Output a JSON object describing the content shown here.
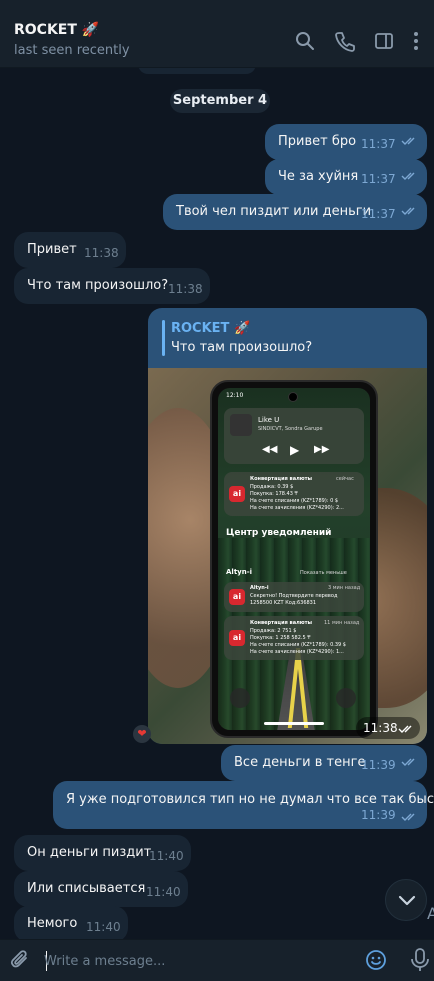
{
  "header": {
    "title": "ROCKET 🚀",
    "status": "last seen recently"
  },
  "date_separator": "September 4",
  "messages": [
    {
      "text": "Привет бро",
      "time": "11:37",
      "dir": "out"
    },
    {
      "text": "Че за хуйня",
      "time": "11:37",
      "dir": "out"
    },
    {
      "text": "Твой чел пиздит или деньги",
      "time": "11:37",
      "dir": "out"
    },
    {
      "text": "Привет",
      "time": "11:38",
      "dir": "in"
    },
    {
      "text": "Что там произошло?",
      "time": "11:38",
      "dir": "in"
    },
    {
      "text": "Все деньги в тенге",
      "time": "11:39",
      "dir": "out"
    },
    {
      "text": "Я уже подготовился тип но не думал что все так быстро",
      "time": "11:39",
      "dir": "out"
    },
    {
      "text": "Он деньги пиздит",
      "time": "11:40",
      "dir": "in"
    },
    {
      "text": "Или  списывается",
      "time": "11:40",
      "dir": "in"
    },
    {
      "text": "Немого",
      "time": "11:40",
      "dir": "in"
    }
  ],
  "media_message": {
    "reply_name": "ROCKET 🚀",
    "reply_text": "Что там произошло?",
    "time": "11:38",
    "reaction": "❤",
    "photo": {
      "status_time": "12:10",
      "music_title": "Like U",
      "music_artist": "SINDICVT, Sondra Garupe",
      "card1": {
        "title": "Конвертация валюты",
        "when": "сейчас",
        "lines": [
          "Продажа: 0.39 $",
          "Покупка: 178.43 ₸",
          "На счете списания (KZ*1789): 0 $",
          "На счете зачисления (KZ*4290): 2..."
        ]
      },
      "center_title": "Центр уведомлений",
      "group_label": "Altyn-i",
      "show_less": "Показать меньше",
      "card2": {
        "title": "Altyn-i",
        "when": "3 мин назад",
        "lines": [
          "Секретно! Подтвердите перевод",
          "1258500 KZT Код:636831"
        ]
      },
      "card3": {
        "title": "Конвертация валюты",
        "when": "11 мин назад",
        "lines": [
          "Продажа: 2 751 $",
          "Покупка: 1 258 582.5 ₸",
          "На счете списания (KZ*1789): 0.39 $",
          "На счете зачисления (KZ*4290): 1..."
        ]
      },
      "app_icon": "ai"
    }
  },
  "input": {
    "placeholder": "Write a message..."
  },
  "icons": {
    "search": "search-icon",
    "call": "phone-icon",
    "sidebar": "sidebar-toggle-icon",
    "more": "more-vertical-icon",
    "attach": "paperclip-icon",
    "emoji": "emoji-icon",
    "mic": "microphone-icon",
    "scroll": "chevron-down-icon"
  },
  "colors": {
    "background": "#0e1621",
    "header": "#17212b",
    "outgoing_bubble": "#2b5278",
    "incoming_bubble": "#182533",
    "accent": "#6ab2f2"
  },
  "edge_glyph": "A"
}
